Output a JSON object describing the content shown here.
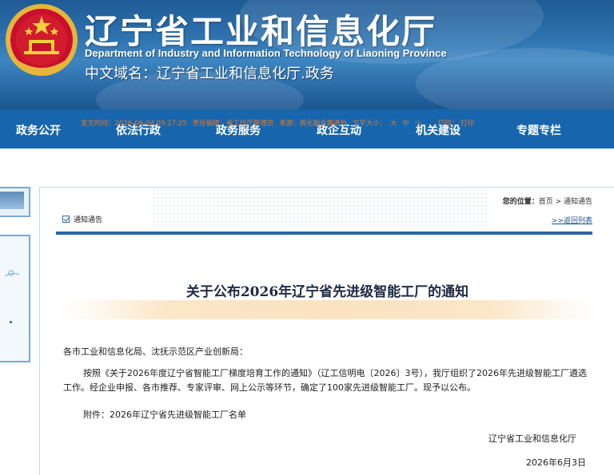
{
  "header": {
    "title": "辽宁省工业和信息化厅",
    "english_name": "Department of Industry and Information Technology of Liaoning Province",
    "domain_label": "中文域名：辽宁省工业和信息化厅.政务",
    "emblem_icon": "national-emblem-icon"
  },
  "nav": {
    "items": [
      "政务公开",
      "依法行政",
      "政务服务",
      "政企互动",
      "机关建设",
      "专题专栏"
    ]
  },
  "breadcrumb": {
    "label": "您的位置：",
    "home": "首页",
    "sep": " > ",
    "current": "通知通告"
  },
  "section": {
    "title": "通知通告",
    "back_link": ">>返回列表"
  },
  "article": {
    "title": "关于公布2026年辽宁省先进级智能工厂的通知",
    "meta": {
      "published": "发文时间：2026-06-04 09:27:25",
      "editor": "责任编辑：省工信厅管理员",
      "source": "来源：两化融合推进处",
      "font_size_label": "文字大小：",
      "size_large": "大",
      "size_medium": "中",
      "size_small": "小",
      "print1": "打印：",
      "print2": "打印"
    },
    "addressee": "各市工业和信息化局、沈抚示范区产业创新局：",
    "body": "按照《关于2026年度辽宁省智能工厂梯度培育工作的通知》（辽工信明电〔2026〕3号），我厅组织了2026年先进级智能工厂遴选工作。经企业申报、各市推荐、专家评审、网上公示等环节，确定了100家先进级智能工厂。现予以公布。",
    "attachment": "附件：2026年辽宁省先进级智能工厂名单",
    "signature": "辽宁省工业和信息化厅",
    "date": "2026年6月3日"
  },
  "colors": {
    "nav_bg": "#1766ad",
    "banner_bg": "#2e73b0",
    "meta_text": "#e0782b",
    "rule": "#2a66a8"
  }
}
